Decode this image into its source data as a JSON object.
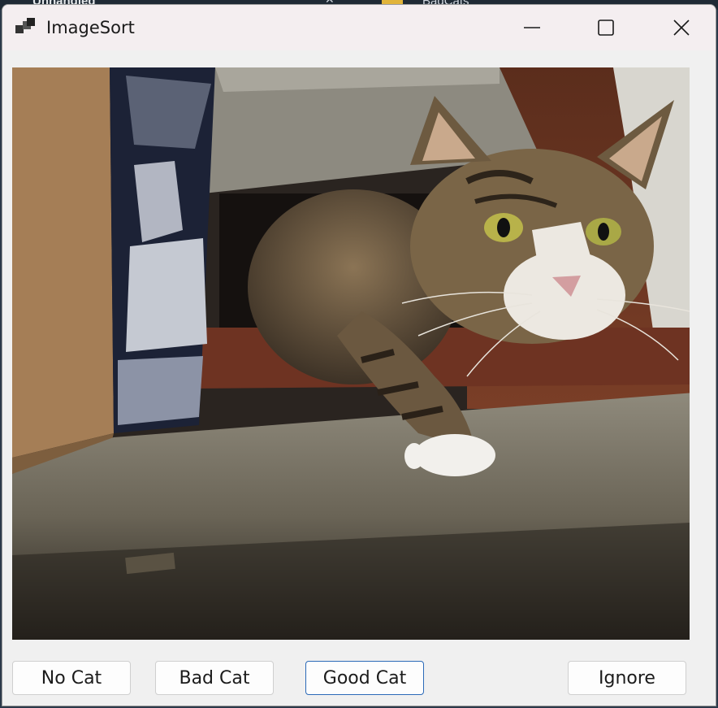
{
  "background": {
    "left_window_title": "Unhandled",
    "right_window_title": "BadCats"
  },
  "window": {
    "title": "ImageSort",
    "app_icon": "app-window-icon",
    "controls": {
      "minimize_icon": "minimize-icon",
      "maximize_icon": "maximize-icon",
      "close_icon": "close-icon"
    }
  },
  "image": {
    "subject": "tabby cat with white paws stepping through a cat flap"
  },
  "buttons": {
    "no_cat": "No Cat",
    "bad_cat": "Bad Cat",
    "good_cat": "Good Cat",
    "ignore": "Ignore"
  },
  "colors": {
    "titlebar": "#f4eef0",
    "window_bg": "#f0f0f0",
    "default_button_border": "#2b6ab8"
  }
}
